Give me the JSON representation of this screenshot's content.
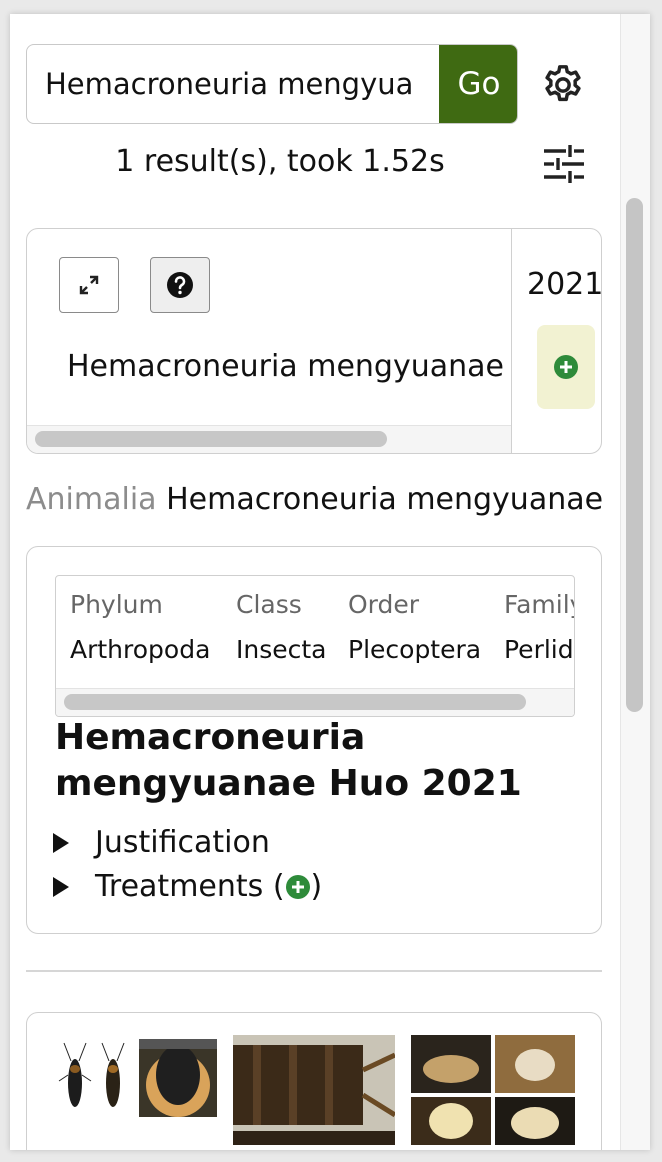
{
  "search": {
    "query": "Hemacroneuria mengyua",
    "go_label": "Go",
    "results_text": "1 result(s), took 1.52s"
  },
  "result_card": {
    "name": "Hemacroneuria mengyuanae",
    "year": "2021"
  },
  "breadcrumb": {
    "kingdom": "Animalia",
    "species": "Hemacroneuria mengyuanae"
  },
  "taxonomy": {
    "headers": [
      "Phylum",
      "Class",
      "Order",
      "Family"
    ],
    "values": [
      "Arthropoda",
      "Insecta",
      "Plecoptera",
      "Perlid"
    ]
  },
  "taxon": {
    "title": "Hemacroneuria mengyuanae Huo 2021",
    "justification_label": "Justification",
    "treatments_label": "Treatments (",
    "treatments_suffix": ")"
  },
  "colors": {
    "go_green": "#3f6a12",
    "plus_green": "#2e8b3a",
    "plus_bg": "#f2f2d2"
  },
  "icons": [
    "gear-icon",
    "filter-sliders-icon",
    "expand-icon",
    "help-icon",
    "add-circle-icon",
    "disclosure-triangle-icon"
  ]
}
